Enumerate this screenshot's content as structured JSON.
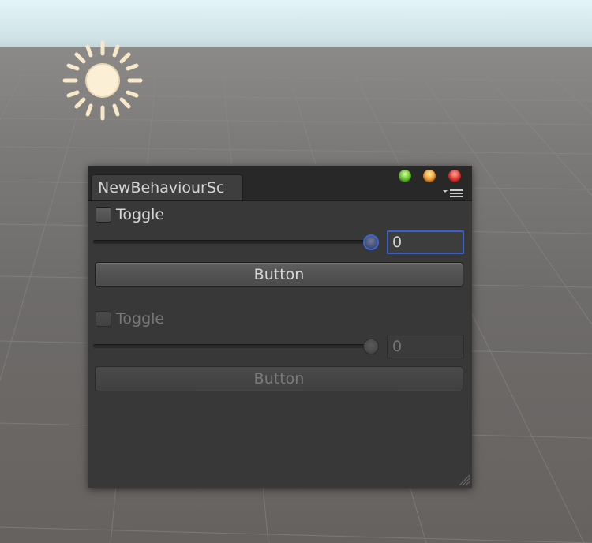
{
  "window": {
    "tab_title": "NewBehaviourSc"
  },
  "enabled_group": {
    "toggle_label": "Toggle",
    "toggle_checked": false,
    "slider_value": 0,
    "number_value": "0",
    "button_label": "Button"
  },
  "disabled_group": {
    "toggle_label": "Toggle",
    "toggle_checked": false,
    "slider_value": 0,
    "number_value": "0",
    "button_label": "Button"
  },
  "icons": {
    "sun": "directional-light-sun-icon",
    "menu": "window-menu-icon",
    "resize": "resize-grip-icon"
  },
  "colors": {
    "focus_accent": "#3c5fd0",
    "window_bg": "#383838"
  }
}
